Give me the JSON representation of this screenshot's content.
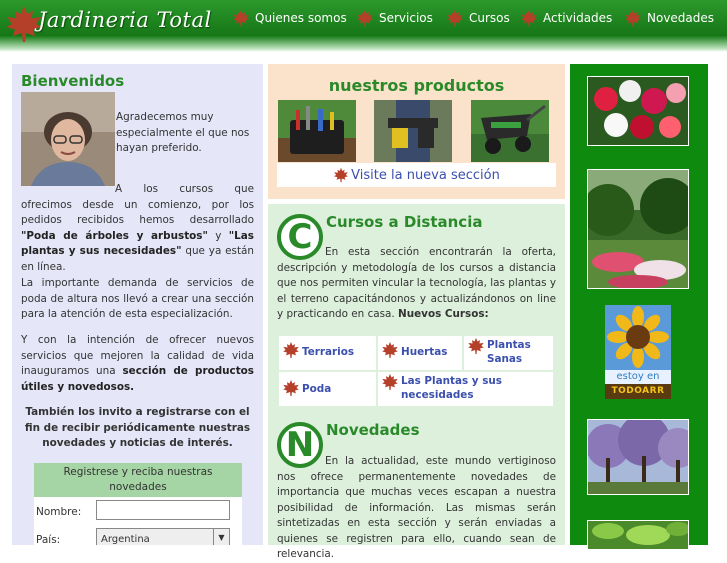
{
  "header": {
    "logo_text": "Jardineria Total",
    "nav": [
      {
        "label": "Quienes somos"
      },
      {
        "label": "Servicios"
      },
      {
        "label": "Cursos"
      },
      {
        "label": "Actividades"
      },
      {
        "label": "Novedades"
      }
    ]
  },
  "welcome": {
    "title": "Bienvenidos",
    "intro": "Agradecemos muy especialmente el que nos hayan preferido.",
    "p1_start": "A los cursos que ofrecimos desde un comienzo, por los pedidos recibidos hemos desarrollado ",
    "p1_bold1": "\"Poda de árboles y arbustos\"",
    "p1_mid": " y ",
    "p1_bold2": "\"Las plantas y sus necesidades\"",
    "p1_end": " que ya están en línea.",
    "p2": "La importante demanda de servicios de poda de altura nos llevó a crear una sección para la atención de esta especialización.",
    "p3_start": "Y con la intención de ofrecer nuevos servicios que mejoren la calidad de vida inauguramos una ",
    "p3_bold": "sección de productos útiles y novedosos.",
    "invite": "También los invito a registrarse con el fin de recibir periódicamente nuestras novedades y noticias de interés."
  },
  "register": {
    "title": "Registrese y reciba nuestras novedades",
    "name_label": "Nombre:",
    "name_value": "",
    "country_label": "País:",
    "country_value": "Argentina"
  },
  "products": {
    "title": "nuestros productos",
    "visit_label": "Visite la nueva sección"
  },
  "courses": {
    "letter": "C",
    "title": "Cursos a Distancia",
    "text": "En esta sección encontrarán la oferta, descripción y metodología de los cursos a distancia que nos permiten vincular la tecnología, las plantas y el terreno capacitándonos y actualizándonos on line y practicando en casa.",
    "new_label": "Nuevos Cursos:",
    "items": [
      {
        "label": "Terrarios"
      },
      {
        "label": "Huertas"
      },
      {
        "label": "Plantas Sanas"
      },
      {
        "label": "Poda"
      },
      {
        "label": "Las Plantas y sus necesidades"
      }
    ]
  },
  "news": {
    "letter": "N",
    "title": "Novedades",
    "text": "En la actualidad, este mundo vertiginoso nos ofrece permanentemente novedades de importancia que muchas veces escapan a nuestra posibilidad de información. Las mismas serán sintetizadas en esta sección y serán enviadas a quienes se registren para ello, cuando sean de relevancia."
  },
  "badge": {
    "line1": "estoy en",
    "line2": "TODOARR"
  },
  "colors": {
    "header_green": "#1a7d1a",
    "title_green": "#2a8a2a",
    "link_blue": "#3a4fae",
    "leaf_red": "#b5402a",
    "left_bg": "#e5e6f8",
    "products_bg": "#fbe2ca",
    "main_bg": "#dcf0dc",
    "right_bg": "#0e8a0e"
  },
  "icons": [
    "maple-leaf-icon",
    "dropdown-arrow-icon"
  ]
}
